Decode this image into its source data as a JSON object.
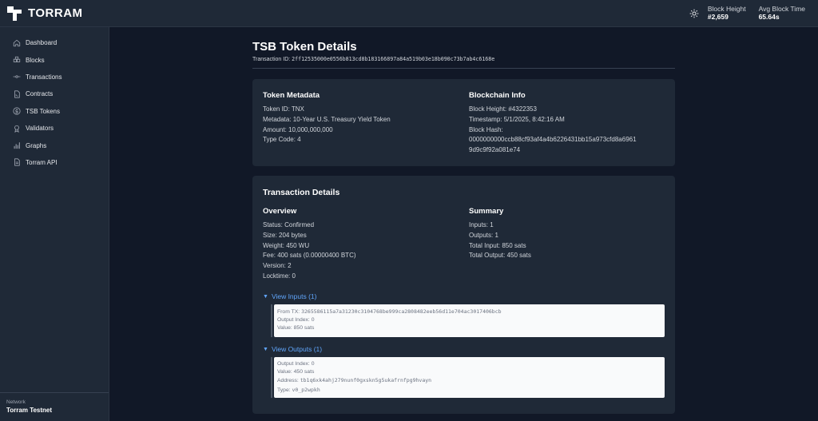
{
  "header": {
    "logo_text": "TORRAM",
    "stats": [
      {
        "label": "Block Height",
        "value": "#2,659"
      },
      {
        "label": "Avg Block Time",
        "value": "65.64s"
      }
    ]
  },
  "sidebar": {
    "items": [
      {
        "label": "Dashboard",
        "icon": "home-icon"
      },
      {
        "label": "Blocks",
        "icon": "blocks-icon"
      },
      {
        "label": "Transactions",
        "icon": "transactions-icon"
      },
      {
        "label": "Contracts",
        "icon": "contract-icon"
      },
      {
        "label": "TSB Tokens",
        "icon": "token-icon"
      },
      {
        "label": "Validators",
        "icon": "validator-icon"
      },
      {
        "label": "Graphs",
        "icon": "chart-icon"
      },
      {
        "label": "Torram API",
        "icon": "document-icon"
      }
    ],
    "network_label": "Network",
    "network_value": "Torram Testnet"
  },
  "page": {
    "title": "TSB Token Details",
    "txid_label": "Transaction ID: ",
    "txid": "2ff12535000e0556b813cd8b183166897a84a519b03e18b090c73b7ab4c6168e"
  },
  "metadata": {
    "heading": "Token Metadata",
    "lines": [
      "Token ID: TNX",
      "Metadata: 10-Year U.S. Treasury Yield Token",
      "Amount: 10,000,000,000",
      "Type Code: 4"
    ]
  },
  "blockchain": {
    "heading": "Blockchain Info",
    "lines": [
      "Block Height: #4322353",
      "Timestamp: 5/1/2025, 8:42:16 AM",
      "Block Hash:",
      "0000000000ccb88cf93af4a4b6226431bb15a973cfd8a6961",
      "9d9c9f92a081e74"
    ]
  },
  "tx": {
    "heading": "Transaction Details",
    "overview_heading": "Overview",
    "overview_lines": [
      "Status: Confirmed",
      "Size: 204 bytes",
      "Weight: 450 WU",
      "Fee: 400 sats (0.00000400 BTC)",
      "Version: 2",
      "Locktime: 0"
    ],
    "summary_heading": "Summary",
    "summary_lines": [
      "Inputs: 1",
      "Outputs: 1",
      "Total Input: 850 sats",
      "Total Output: 450 sats"
    ],
    "inputs_toggle": "View Inputs (1)",
    "input": {
      "from_label": "From TX: ",
      "from_tx": "3265586115a7a31230c3104768be999ca2808482eeb56d11e704ac3017406bcb",
      "output_index": "Output Index: 0",
      "value": "Value: 850 sats"
    },
    "outputs_toggle": "View Outputs (1)",
    "output": {
      "output_index": "Output Index: 0",
      "value": "Value: 450 sats",
      "address_label": "Address: ",
      "address": "tb1q6xk4ahj279nunf0gxskn5g5ukafrnfpg9hvayn",
      "type_label": "Type: ",
      "type": "v0_p2wpkh"
    }
  }
}
